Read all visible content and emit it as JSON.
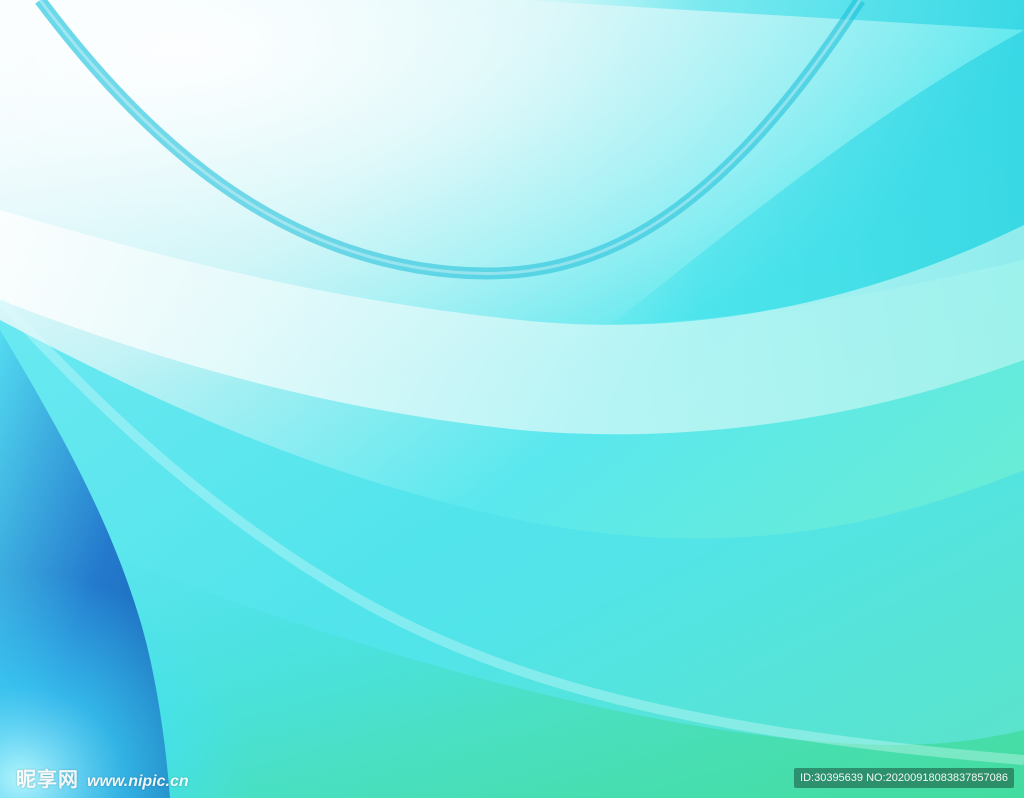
{
  "watermark": {
    "brand_text": "昵享网",
    "site_url": "www.nipic.cn",
    "id_text": "ID:30395639 NO:20200918083837857086"
  },
  "palette": {
    "cyan_light": "#7fe6ec",
    "cyan_mid": "#2fd4e3",
    "aqua_green": "#57e1c8",
    "green_accent": "#39d98f",
    "blue_deep": "#1a66c7",
    "white_highlight": "#f4fbff"
  }
}
